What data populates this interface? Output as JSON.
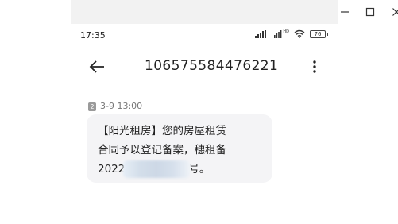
{
  "status_bar": {
    "time": "17:35",
    "network_label": "HD",
    "battery": "76"
  },
  "header": {
    "title": "106575584476221"
  },
  "message": {
    "sim_slot": "2",
    "timestamp": "3-9 13:00",
    "lines": [
      "【阳光租房】您的房屋租赁",
      "合同予以登记备案，穗租备"
    ],
    "line3_prefix": "2022",
    "line3_suffix": "号。"
  }
}
